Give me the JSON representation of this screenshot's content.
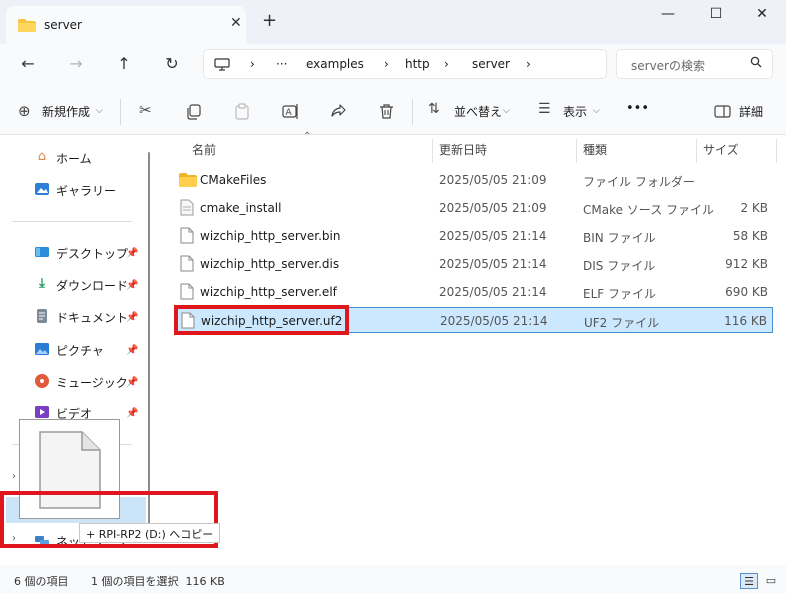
{
  "window": {
    "tab_title": "server",
    "new_tab": "+",
    "minimize": "—",
    "maximize": "☐",
    "close": "✕"
  },
  "nav": {
    "back": "←",
    "forward": "→",
    "up": "↑",
    "refresh": "↻",
    "breadcrumb": [
      "examples",
      "http",
      "server"
    ],
    "more": "···",
    "separator": "›",
    "search_placeholder": "serverの検索"
  },
  "toolbar": {
    "new_label": "新規作成",
    "sort_label": "並べ替え",
    "view_label": "表示",
    "more": "•••",
    "details_label": "詳細"
  },
  "sidebar": {
    "items_top": [
      {
        "label": "ホーム",
        "icon": "home-icon"
      },
      {
        "label": "ギャラリー",
        "icon": "gallery-icon"
      }
    ],
    "items_quick": [
      {
        "label": "デスクトップ",
        "icon": "desktop-icon"
      },
      {
        "label": "ダウンロード",
        "icon": "download-icon"
      },
      {
        "label": "ドキュメント",
        "icon": "documents-icon"
      },
      {
        "label": "ピクチャ",
        "icon": "pictures-icon"
      },
      {
        "label": "ミュージック",
        "icon": "music-icon"
      },
      {
        "label": "ビデオ",
        "icon": "video-icon"
      }
    ],
    "network_label": "ネットワーク"
  },
  "columns": {
    "name": "名前",
    "date": "更新日時",
    "type": "種類",
    "size": "サイズ"
  },
  "files": [
    {
      "name": "CMakeFiles",
      "date": "2025/05/05 21:09",
      "type": "ファイル フォルダー",
      "size": "",
      "kind": "folder"
    },
    {
      "name": "cmake_install",
      "date": "2025/05/05 21:09",
      "type": "CMake ソース ファイル",
      "size": "2 KB",
      "kind": "cmake"
    },
    {
      "name": "wizchip_http_server.bin",
      "date": "2025/05/05 21:14",
      "type": "BIN ファイル",
      "size": "58 KB",
      "kind": "file"
    },
    {
      "name": "wizchip_http_server.dis",
      "date": "2025/05/05 21:14",
      "type": "DIS ファイル",
      "size": "912 KB",
      "kind": "file"
    },
    {
      "name": "wizchip_http_server.elf",
      "date": "2025/05/05 21:14",
      "type": "ELF ファイル",
      "size": "690 KB",
      "kind": "file"
    },
    {
      "name": "wizchip_http_server.uf2",
      "date": "2025/05/05 21:14",
      "type": "UF2 ファイル",
      "size": "116 KB",
      "kind": "file",
      "selected": true
    }
  ],
  "status": {
    "item_count": "6 個の項目",
    "selection": "1 個の項目を選択  116 KB"
  },
  "drag": {
    "tooltip": "+ RPI-RP2 (D:) へコピー"
  },
  "colors": {
    "selection_bg": "#cce8ff",
    "selection_border": "#4d8fd1",
    "highlight_red": "#e0161e",
    "folder_yellow": "#f5c542"
  }
}
